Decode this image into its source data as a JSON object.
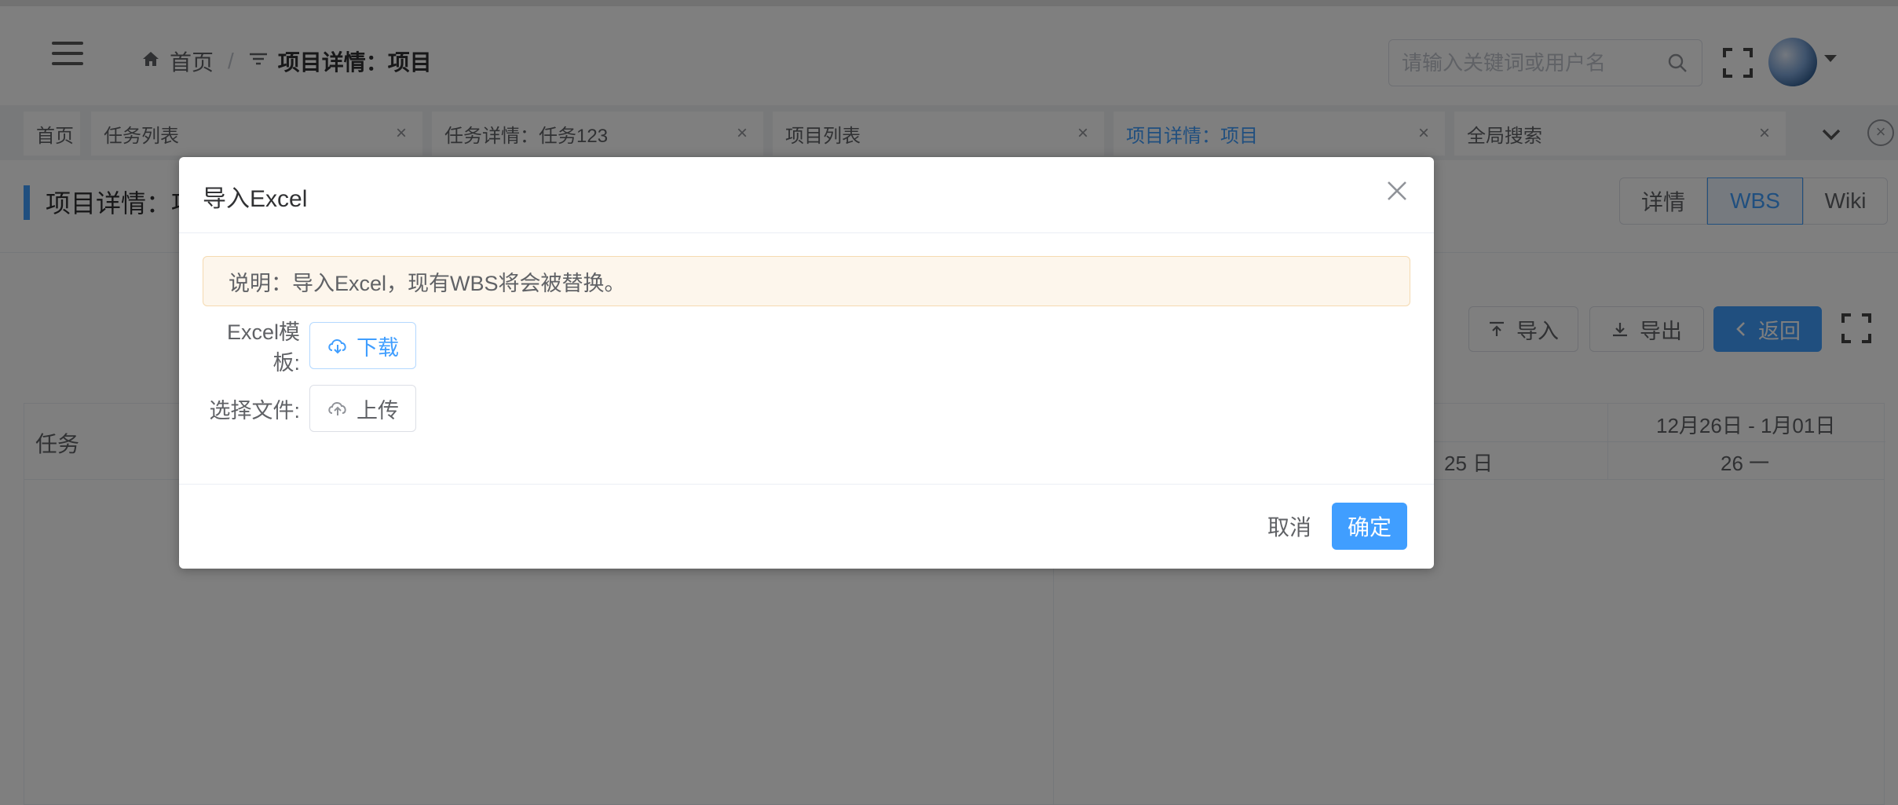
{
  "header": {
    "breadcrumb": {
      "home": "首页",
      "separator": "/",
      "current": "项目详情：项目"
    },
    "search": {
      "placeholder": "请输入关键词或用户名"
    }
  },
  "tabs": [
    {
      "label": "首页",
      "closable": false,
      "active": false
    },
    {
      "label": "任务列表",
      "closable": true,
      "active": false
    },
    {
      "label": "任务详情：任务123",
      "closable": true,
      "active": false
    },
    {
      "label": "项目列表",
      "closable": true,
      "active": false
    },
    {
      "label": "项目详情：项目",
      "closable": true,
      "active": true
    },
    {
      "label": "全局搜索",
      "closable": true,
      "active": false
    }
  ],
  "page": {
    "title": "项目详情：项",
    "segments": [
      "详情",
      "WBS",
      "Wiki"
    ],
    "active_segment": "WBS",
    "toolbar": {
      "import": "导入",
      "export": "导出",
      "back": "返回"
    }
  },
  "grid": {
    "task_header": "任务",
    "week": "12月26日 - 1月01日",
    "days": [
      "25 日",
      "26 一"
    ]
  },
  "dialog": {
    "title": "导入Excel",
    "notice": "说明：导入Excel，现有WBS将会被替换。",
    "template_label": "Excel模板:",
    "download": "下载",
    "file_label": "选择文件:",
    "upload": "上传",
    "cancel": "取消",
    "confirm": "确定"
  },
  "colors": {
    "primary": "#409eff",
    "warning_bg": "#fdf6ec",
    "overlay": "rgba(0,0,0,0.5)"
  }
}
